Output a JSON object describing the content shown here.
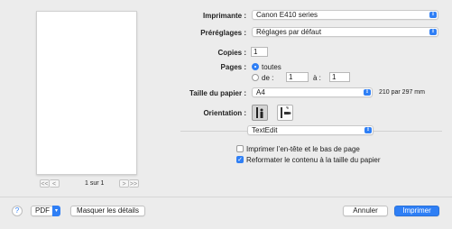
{
  "preview": {
    "page_indicator": "1 sur 1",
    "first_label": "<<",
    "prev_label": "<",
    "next_label": ">",
    "last_label": ">>"
  },
  "printer": {
    "label": "Imprimante :",
    "value": "Canon E410 series"
  },
  "presets": {
    "label": "Préréglages :",
    "value": "Réglages par défaut"
  },
  "copies": {
    "label": "Copies :",
    "value": "1"
  },
  "pages": {
    "label": "Pages :",
    "all_label": "toutes",
    "from_label": "de :",
    "from_value": "1",
    "to_label": "à :",
    "to_value": "1",
    "selected": "all"
  },
  "paper_size": {
    "label": "Taille du papier :",
    "value": "A4",
    "dimensions": "210 par 297 mm"
  },
  "orientation": {
    "label": "Orientation :",
    "selected": "portrait"
  },
  "app_menu": {
    "value": "TextEdit"
  },
  "options": [
    {
      "label": "Imprimer l’en-tête et le bas de page",
      "checked": false
    },
    {
      "label": "Reformater le contenu à la taille du papier",
      "checked": true
    }
  ],
  "footer": {
    "help_label": "?",
    "pdf_label": "PDF",
    "hide_details_label": "Masquer les détails",
    "cancel_label": "Annuler",
    "print_label": "Imprimer"
  },
  "colors": {
    "accent": "#2f7ff5",
    "background": "#ececec"
  }
}
